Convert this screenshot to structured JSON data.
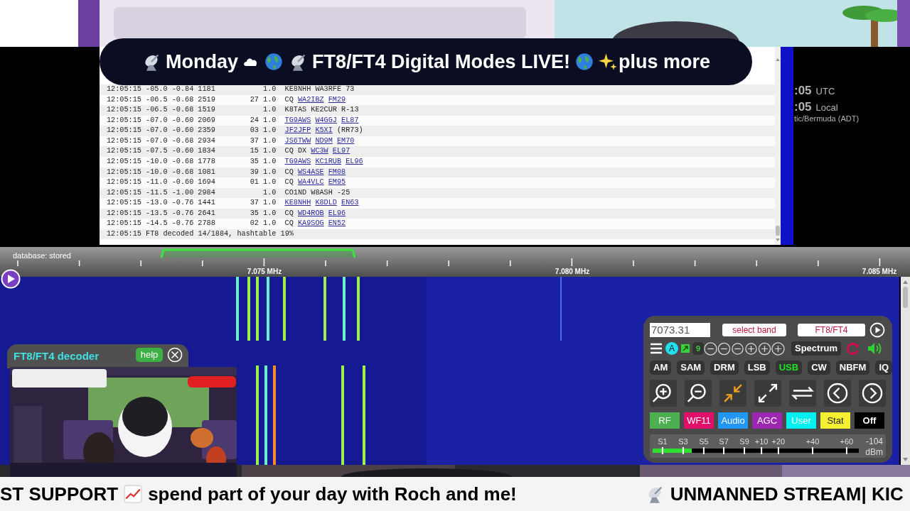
{
  "banner": {
    "texts": [
      "Monday",
      "FT8/FT4 Digital Modes LIVE!",
      "plus more"
    ]
  },
  "log": {
    "rows": [
      {
        "time": "12:05:15",
        "snr": "-05.0",
        "dt": "-0.84",
        "freq": "1181",
        "drift": "1.0",
        "message": [
          {
            "text": "KE8NHH",
            "link": false
          },
          {
            "text": "WA3RFE",
            "link": false
          },
          {
            "text": "73",
            "link": false
          }
        ]
      },
      {
        "time": "12:05:15",
        "snr": "-06.5",
        "dt": "-0.68",
        "freq": "2519",
        "dist": "27",
        "drift": "1.0",
        "message": [
          {
            "text": "CQ",
            "link": false
          },
          {
            "text": "WA2IBZ",
            "link": true
          },
          {
            "text": "FM29",
            "link": true
          }
        ]
      },
      {
        "time": "12:05:15",
        "snr": "-06.5",
        "dt": "-0.68",
        "freq": "1519",
        "drift": "1.0",
        "message": [
          {
            "text": "K8TAS",
            "link": false
          },
          {
            "text": "KE2CUR",
            "link": false
          },
          {
            "text": "R-13",
            "link": false
          }
        ]
      },
      {
        "time": "12:05:15",
        "snr": "-07.0",
        "dt": "-0.60",
        "freq": "2069",
        "dist": "24",
        "drift": "1.0",
        "message": [
          {
            "text": "TG9AWS",
            "link": true
          },
          {
            "text": "W4GGJ",
            "link": true
          },
          {
            "text": "EL87",
            "link": true
          }
        ]
      },
      {
        "time": "12:05:15",
        "snr": "-07.0",
        "dt": "-0.60",
        "freq": "2359",
        "dist": "03",
        "drift": "1.0",
        "message": [
          {
            "text": "JF2JFP",
            "link": true
          },
          {
            "text": "K5XI",
            "link": true
          },
          {
            "text": "(RR73)",
            "link": false
          }
        ]
      },
      {
        "time": "12:05:15",
        "snr": "-07.0",
        "dt": "-0.68",
        "freq": "2934",
        "dist": "37",
        "drift": "1.0",
        "message": [
          {
            "text": "JS6TWW",
            "link": true
          },
          {
            "text": "ND9M",
            "link": true
          },
          {
            "text": "EM70",
            "link": true
          }
        ]
      },
      {
        "time": "12:05:15",
        "snr": "-07.5",
        "dt": "-0.60",
        "freq": "1834",
        "dist": "15",
        "drift": "1.0",
        "message": [
          {
            "text": "CQ",
            "link": false
          },
          {
            "text": "DX",
            "link": false
          },
          {
            "text": "WC3W",
            "link": true
          },
          {
            "text": "EL97",
            "link": true
          }
        ]
      },
      {
        "time": "12:05:15",
        "snr": "-10.0",
        "dt": "-0.68",
        "freq": "1778",
        "dist": "35",
        "drift": "1.0",
        "message": [
          {
            "text": "TG9AWS",
            "link": true
          },
          {
            "text": "KC1RUB",
            "link": true
          },
          {
            "text": "EL96",
            "link": true
          }
        ]
      },
      {
        "time": "12:05:15",
        "snr": "-10.0",
        "dt": "-0.68",
        "freq": "1081",
        "dist": "39",
        "drift": "1.0",
        "message": [
          {
            "text": "CQ",
            "link": false
          },
          {
            "text": "WS4ASE",
            "link": true
          },
          {
            "text": "FM08",
            "link": true
          }
        ]
      },
      {
        "time": "12:05:15",
        "snr": "-11.0",
        "dt": "-0.60",
        "freq": "1694",
        "dist": "01",
        "drift": "1.0",
        "message": [
          {
            "text": "CQ",
            "link": false
          },
          {
            "text": "WA4VLC",
            "link": true
          },
          {
            "text": "EM95",
            "link": true
          }
        ]
      },
      {
        "time": "12:05:15",
        "snr": "-11.5",
        "dt": "-1.00",
        "freq": "2984",
        "drift": "1.0",
        "message": [
          {
            "text": "CO1ND",
            "link": false
          },
          {
            "text": "W8ASH",
            "link": false
          },
          {
            "text": "-25",
            "link": false
          }
        ]
      },
      {
        "time": "12:05:15",
        "snr": "-13.0",
        "dt": "-0.76",
        "freq": "1441",
        "dist": "37",
        "drift": "1.0",
        "message": [
          {
            "text": "KE8NHH",
            "link": true
          },
          {
            "text": "K8DLD",
            "link": true
          },
          {
            "text": "EN63",
            "link": true
          }
        ]
      },
      {
        "time": "12:05:15",
        "snr": "-13.5",
        "dt": "-0.76",
        "freq": "2641",
        "dist": "35",
        "drift": "1.0",
        "message": [
          {
            "text": "CQ",
            "link": false
          },
          {
            "text": "WD4ROB",
            "link": true
          },
          {
            "text": "EL96",
            "link": true
          }
        ]
      },
      {
        "time": "12:05:15",
        "snr": "-14.5",
        "dt": "-0.76",
        "freq": "2788",
        "dist": "02",
        "drift": "1.0",
        "message": [
          {
            "text": "CQ",
            "link": false
          },
          {
            "text": "KA9SOG",
            "link": true
          },
          {
            "text": "EN52",
            "link": true
          }
        ]
      }
    ],
    "status": "12:05:15 FT8 decoded 14/1884, hashtable 19%"
  },
  "clock": {
    "utc_time": ":05",
    "utc_label": "UTC",
    "local_time": ":05",
    "local_label": "Local",
    "timezone": "tic/Bermuda (ADT)"
  },
  "scale": {
    "database": "database: stored",
    "labels": [
      "7.075 MHz",
      "7.080 MHz",
      "7.085 MHz"
    ]
  },
  "decoder": {
    "title": "FT8/FT4 decoder",
    "help": "help"
  },
  "controls": {
    "frequency": "7073.31",
    "band_select": "select band",
    "mode_select": "FT8/FT4",
    "antenna": "A",
    "badge": "9",
    "spectrum": "Spectrum",
    "modes": [
      {
        "label": "AM",
        "selected": false
      },
      {
        "label": "SAM",
        "selected": false
      },
      {
        "label": "DRM",
        "selected": false
      },
      {
        "label": "LSB",
        "selected": false
      },
      {
        "label": "USB",
        "selected": true
      },
      {
        "label": "CW",
        "selected": false
      },
      {
        "label": "NBFM",
        "selected": false
      },
      {
        "label": "IQ",
        "selected": false
      }
    ],
    "panels": [
      {
        "label": "RF",
        "color": "#4caf50"
      },
      {
        "label": "WF11",
        "color": "#e0106a"
      },
      {
        "label": "Audio",
        "color": "#2196f3"
      },
      {
        "label": "AGC",
        "color": "#9c27b0"
      },
      {
        "label": "User",
        "color": "#00f0f0"
      },
      {
        "label": "Stat",
        "color": "#f5f032"
      },
      {
        "label": "Off",
        "color": "#000000"
      }
    ],
    "smeter": {
      "labels": [
        "S1",
        "S3",
        "S5",
        "S7",
        "S9",
        "+10",
        "+20",
        "+40",
        "+60"
      ],
      "reading": "-104",
      "unit": "dBm",
      "level": 0.19
    }
  },
  "ticker": {
    "texts": [
      "ST SUPPORT",
      "spend part of your day with Roch and me!",
      "UNMANNED STREAM| KIC"
    ]
  }
}
